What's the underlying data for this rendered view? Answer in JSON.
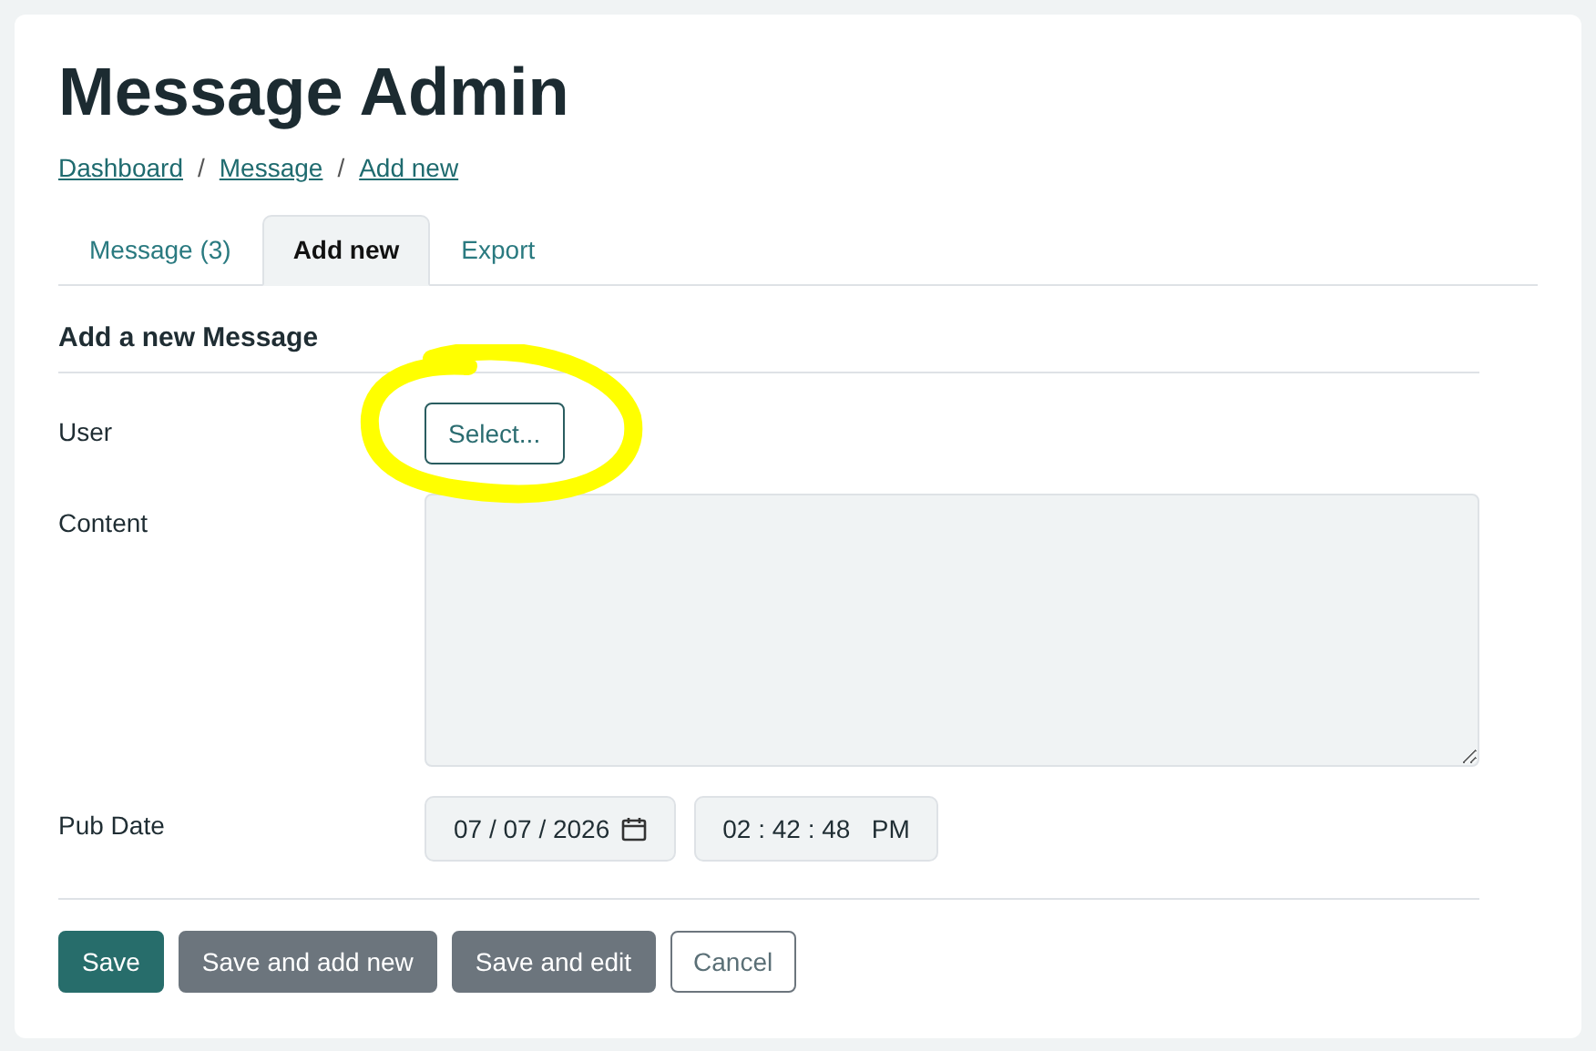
{
  "title": "Message Admin",
  "breadcrumbs": [
    {
      "label": "Dashboard"
    },
    {
      "separator": "/",
      "label": "Message"
    },
    {
      "separator": "/",
      "label": "Add new"
    }
  ],
  "tabs": [
    {
      "label": "Message (3)",
      "selected": false
    },
    {
      "label": "Add new",
      "selected": true
    },
    {
      "label": "Export",
      "selected": false
    }
  ],
  "form": {
    "heading": "Add a new Message",
    "user": {
      "label": "User",
      "button": "Select...",
      "highlighted": true
    },
    "content": {
      "label": "Content"
    },
    "pub_date": {
      "label": "Pub Date",
      "date": "07 / 07 / 2026",
      "time": "02 : 42 : 48   PM"
    }
  },
  "buttons": [
    {
      "label": "Save",
      "kind": "primary"
    },
    {
      "label": "Save and add new",
      "kind": "secondary"
    },
    {
      "label": "Save and edit",
      "kind": "secondary"
    },
    {
      "label": "Cancel",
      "kind": "outline"
    }
  ]
}
